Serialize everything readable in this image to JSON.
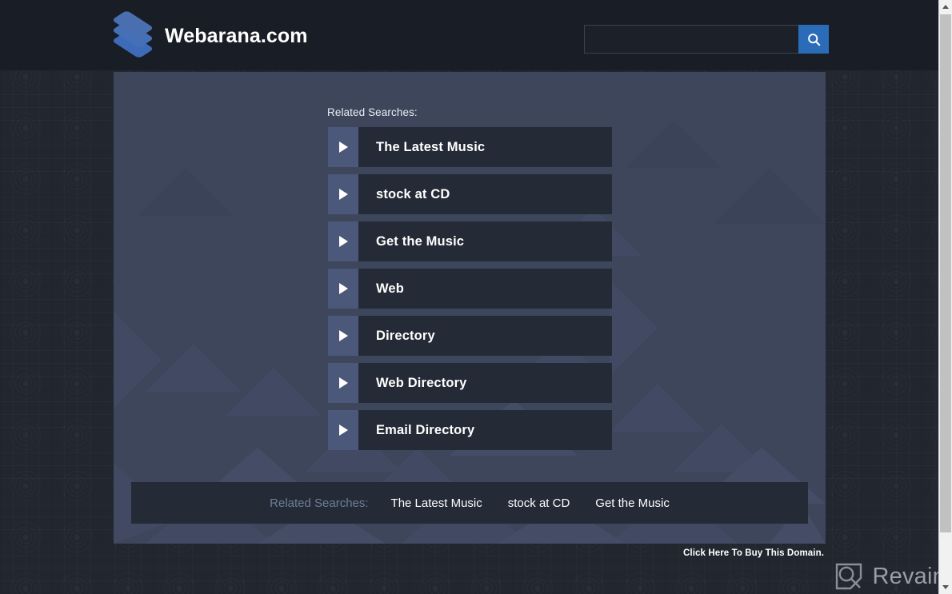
{
  "header": {
    "brand_title": "Webarana.com",
    "logo_icon": "stacked-layers-icon",
    "search": {
      "value": "",
      "placeholder": "",
      "button_icon": "search-icon"
    }
  },
  "main": {
    "related_label": "Related Searches:",
    "items": [
      {
        "label": "The Latest Music",
        "icon": "play-arrow-icon"
      },
      {
        "label": "stock at CD",
        "icon": "play-arrow-icon"
      },
      {
        "label": "Get the Music",
        "icon": "play-arrow-icon"
      },
      {
        "label": "Web",
        "icon": "play-arrow-icon"
      },
      {
        "label": "Directory",
        "icon": "play-arrow-icon"
      },
      {
        "label": "Web Directory",
        "icon": "play-arrow-icon"
      },
      {
        "label": "Email Directory",
        "icon": "play-arrow-icon"
      }
    ],
    "bottom_bar": {
      "label": "Related Searches:",
      "links": [
        "The Latest Music",
        "stock at CD",
        "Get the Music"
      ]
    }
  },
  "footer": {
    "buy_domain": "Click Here To Buy This Domain."
  },
  "watermark": {
    "text": "Revain",
    "icon": "revain-logo-icon"
  },
  "scrollbar": {
    "up_icon": "chevron-up-icon",
    "down_icon": "chevron-down-icon"
  },
  "colors": {
    "page_bg": "#22262f",
    "header_bg": "#191d25",
    "panel_bg": "#3e465c",
    "item_bg": "#242a36",
    "arrow_box_bg": "#4c587a",
    "accent_blue": "#2b6cb8",
    "muted_label": "#6f7e99"
  }
}
